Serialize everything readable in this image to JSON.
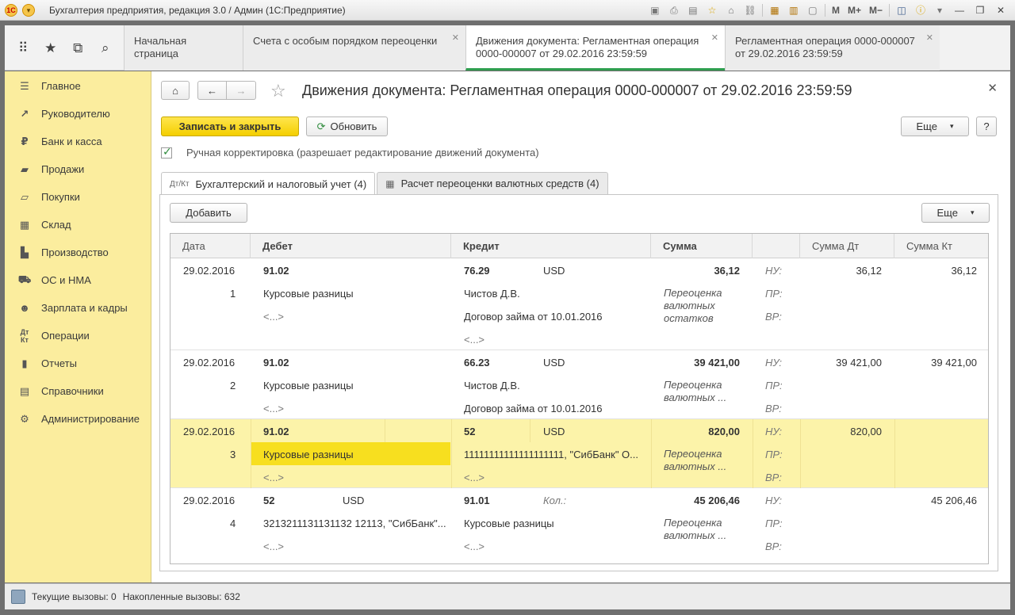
{
  "window": {
    "title": "Бухгалтерия предприятия, редакция 3.0 / Админ  (1С:Предприятие)",
    "m_label": "M",
    "mplus_label": "M+",
    "mminus_label": "M−"
  },
  "tabs": [
    {
      "label": "Начальная страница"
    },
    {
      "label": "Счета с особым порядком переоценки"
    },
    {
      "label": "Движения документа: Регламентная операция 0000-000007 от 29.02.2016 23:59:59"
    },
    {
      "label": "Регламентная операция 0000-000007 от 29.02.2016 23:59:59"
    }
  ],
  "sidebar": {
    "items": [
      {
        "label": "Главное",
        "icon": "menu-icon"
      },
      {
        "label": "Руководителю",
        "icon": "trend-icon"
      },
      {
        "label": "Банк и касса",
        "icon": "coin-icon"
      },
      {
        "label": "Продажи",
        "icon": "bag-icon"
      },
      {
        "label": "Покупки",
        "icon": "cart-icon"
      },
      {
        "label": "Склад",
        "icon": "warehouse-icon"
      },
      {
        "label": "Производство",
        "icon": "factory-icon"
      },
      {
        "label": "ОС и НМА",
        "icon": "truck-icon"
      },
      {
        "label": "Зарплата и кадры",
        "icon": "people-icon"
      },
      {
        "label": "Операции",
        "icon": "dtkt-icon"
      },
      {
        "label": "Отчеты",
        "icon": "chart-icon"
      },
      {
        "label": "Справочники",
        "icon": "book-icon"
      },
      {
        "label": "Администрирование",
        "icon": "gear-icon"
      }
    ]
  },
  "form": {
    "title": "Движения документа: Регламентная операция 0000-000007 от 29.02.2016 23:59:59",
    "save_close_label": "Записать и закрыть",
    "refresh_label": "Обновить",
    "more_label": "Еще",
    "help_label": "?",
    "manual_correction_label": "Ручная корректировка (разрешает редактирование движений документа)",
    "manual_correction_checked": true,
    "subtabs": [
      {
        "label": "Бухгалтерский и налоговый учет (4)"
      },
      {
        "label": "Расчет переоценки валютных средств (4)"
      }
    ],
    "add_label": "Добавить",
    "table_more_label": "Еще"
  },
  "grid": {
    "columns": {
      "date": "Дата",
      "debit": "Дебет",
      "credit": "Кредит",
      "sum": "Сумма",
      "sum_dt": "Сумма Дт",
      "sum_kt": "Сумма Кт"
    },
    "rows": [
      {
        "date": "29.02.2016",
        "num": "1",
        "debit_account": "91.02",
        "debit_currency": "",
        "debit_sub1": "Курсовые разницы",
        "debit_sub2": "<...>",
        "credit_account": "76.29",
        "credit_currency": "USD",
        "credit_sub1": "Чистов Д.В.",
        "credit_sub2": "Договор займа от 10.01.2016",
        "credit_sub3": "<...>",
        "sum": "36,12",
        "content": "Переоценка валютных остатков",
        "nu": "НУ:",
        "pr": "ПР:",
        "vr": "ВР:",
        "sum_dt": "36,12",
        "sum_kt": "36,12"
      },
      {
        "date": "29.02.2016",
        "num": "2",
        "debit_account": "91.02",
        "debit_currency": "",
        "debit_sub1": "Курсовые разницы",
        "debit_sub2": "<...>",
        "credit_account": "66.23",
        "credit_currency": "USD",
        "credit_sub1": "Чистов Д.В.",
        "credit_sub2": "Договор займа от 10.01.2016",
        "credit_sub3": "",
        "sum": "39 421,00",
        "content": "Переоценка валютных ...",
        "nu": "НУ:",
        "pr": "ПР:",
        "vr": "ВР:",
        "sum_dt": "39 421,00",
        "sum_kt": "39 421,00"
      },
      {
        "date": "29.02.2016",
        "num": "3",
        "debit_account": "91.02",
        "debit_currency": "",
        "debit_sub1": "Курсовые разницы",
        "debit_sub2": "<...>",
        "credit_account": "52",
        "credit_currency": "USD",
        "credit_sub1": "11111111111111111111, \"СибБанк\" О...",
        "credit_sub2": "<...>",
        "credit_sub3": "",
        "sum": "820,00",
        "content": "Переоценка валютных ...",
        "nu": "НУ:",
        "pr": "ПР:",
        "vr": "ВР:",
        "sum_dt": "820,00",
        "sum_kt": ""
      },
      {
        "date": "29.02.2016",
        "num": "4",
        "debit_account": "52",
        "debit_currency": "USD",
        "debit_sub1": "3213211131131132 12113, \"СибБанк\"...",
        "debit_sub2": "<...>",
        "credit_account": "91.01",
        "credit_currency": "",
        "credit_sub1": "Курсовые разницы",
        "credit_sub2": "<...>",
        "credit_sub3": "",
        "credit_qty_label": "Кол.:",
        "sum": "45 206,46",
        "content": "Переоценка валютных ...",
        "nu": "НУ:",
        "pr": "ПР:",
        "vr": "ВР:",
        "sum_dt": "",
        "sum_kt": "45 206,46"
      }
    ]
  },
  "status": {
    "current_calls": "Текущие вызовы: 0",
    "accumulated_calls": "Накопленные вызовы: 632"
  }
}
